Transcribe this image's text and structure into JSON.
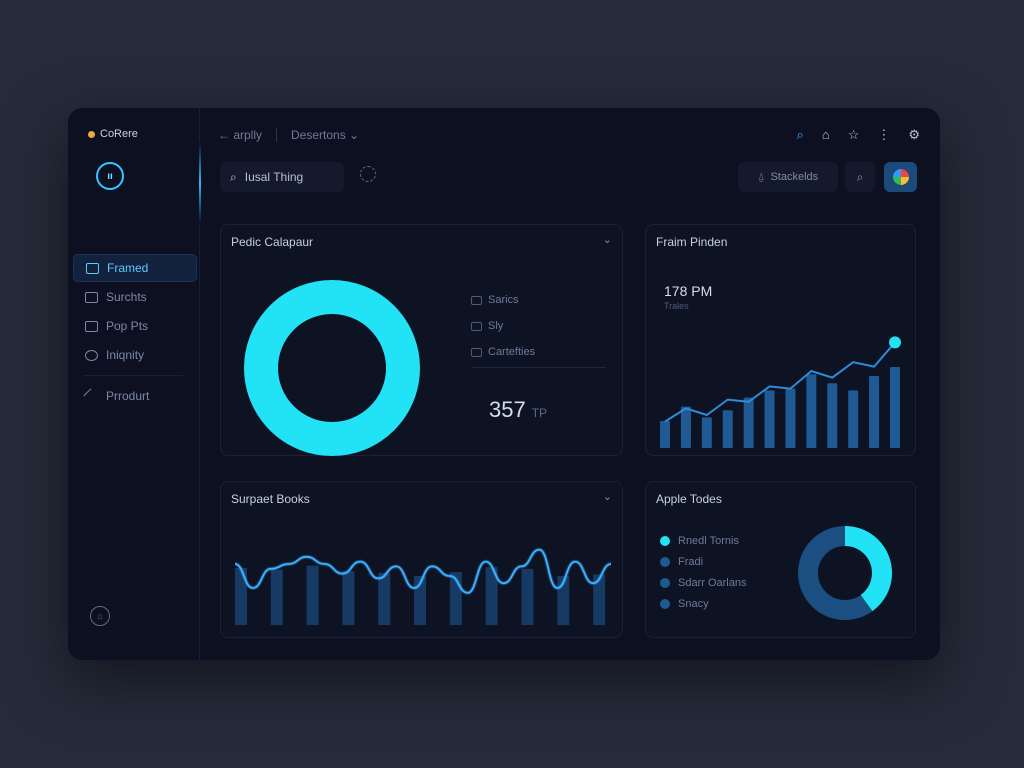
{
  "brand": {
    "name": "CoRere"
  },
  "sidebar": {
    "items": [
      {
        "label": "Framed",
        "active": true
      },
      {
        "label": "Surchts",
        "active": false
      },
      {
        "label": "Pop Pts",
        "active": false
      },
      {
        "label": "Iniqnity",
        "active": false
      },
      {
        "label": "Prrodurt",
        "active": false
      }
    ]
  },
  "topbar": {
    "back_label": "← arplly",
    "dropdown_label": "Desertons ⌄"
  },
  "search": {
    "value": "Iusal Thing"
  },
  "actions": {
    "stack_label": "Stackelds"
  },
  "cards": {
    "donut": {
      "title": "Pedic Calapaur",
      "legend": [
        "Sarics",
        "Sly",
        "Cartefties"
      ],
      "value": "357",
      "unit": "TP"
    },
    "trend": {
      "title": "Fraim Pinden",
      "stat": "178 PM",
      "stat_sub": "Trales"
    },
    "wave": {
      "title": "Surpaet Books"
    },
    "apple": {
      "title": "Apple Todes",
      "legend": [
        "Rnedl Tornis",
        "Fradi",
        "Sdarr Oarlans",
        "Snacy"
      ]
    }
  },
  "colors": {
    "accent": "#22e3f5",
    "accent_blue": "#3aa8ff",
    "bar": "#1f5a95",
    "line": "#2e8bd6"
  },
  "icons": [
    "search-icon",
    "home-icon",
    "star-icon",
    "more-icon",
    "settings-icon",
    "bell-icon",
    "lock-icon"
  ],
  "chart_data": [
    {
      "type": "pie",
      "title": "Pedic Calapaur",
      "values": [
        100
      ],
      "labels": [
        "Sarics"
      ]
    },
    {
      "type": "bar",
      "title": "Fraim Pinden",
      "values": [
        30,
        46,
        34,
        42,
        56,
        64,
        66,
        82,
        72,
        64,
        80,
        90
      ],
      "line": [
        24,
        36,
        30,
        44,
        42,
        56,
        54,
        70,
        64,
        78,
        74,
        96
      ]
    },
    {
      "type": "area",
      "title": "Surpaet Books",
      "values": [
        20,
        40,
        24,
        20,
        14,
        20,
        28,
        18,
        32,
        22,
        40,
        22,
        30,
        44,
        18,
        36,
        22,
        8,
        40,
        18,
        36,
        20
      ]
    },
    {
      "type": "pie",
      "title": "Apple Todes",
      "values": [
        40,
        60
      ],
      "labels": [
        "Rnedl Tornis",
        "Snacy"
      ]
    }
  ]
}
